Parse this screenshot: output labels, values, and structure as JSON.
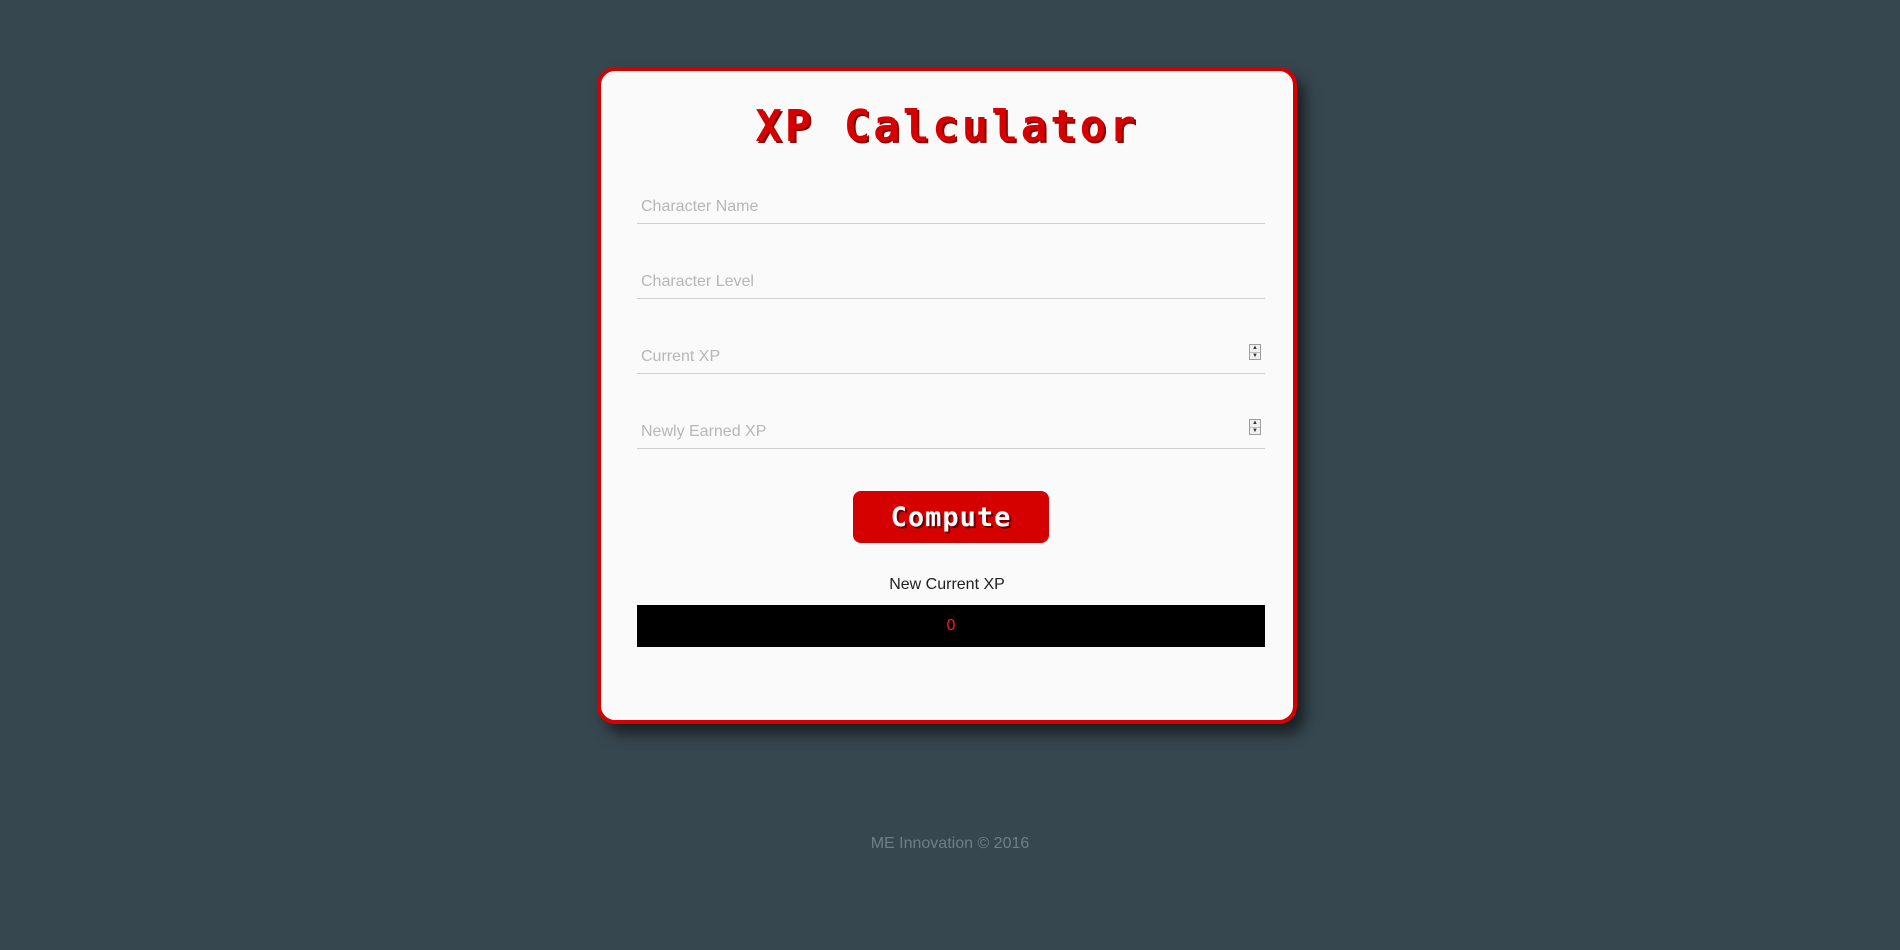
{
  "app": {
    "title": "XP Calculator"
  },
  "form": {
    "character_name": {
      "placeholder": "Character Name",
      "value": ""
    },
    "character_level": {
      "placeholder": "Character Level",
      "value": ""
    },
    "current_xp": {
      "placeholder": "Current XP",
      "value": ""
    },
    "newly_earned_xp": {
      "placeholder": "Newly Earned XP",
      "value": ""
    }
  },
  "actions": {
    "compute_label": "Compute"
  },
  "result": {
    "label": "New Current XP",
    "value": "0"
  },
  "footer": {
    "text": "ME Innovation © 2016"
  },
  "colors": {
    "background": "#37474f",
    "accent": "#d50000",
    "card": "#fafafa",
    "result_bg": "#000000",
    "result_text": "#ff1a1a"
  },
  "icons": {
    "spinner_up": "triangle-up-icon",
    "spinner_down": "triangle-down-icon"
  }
}
